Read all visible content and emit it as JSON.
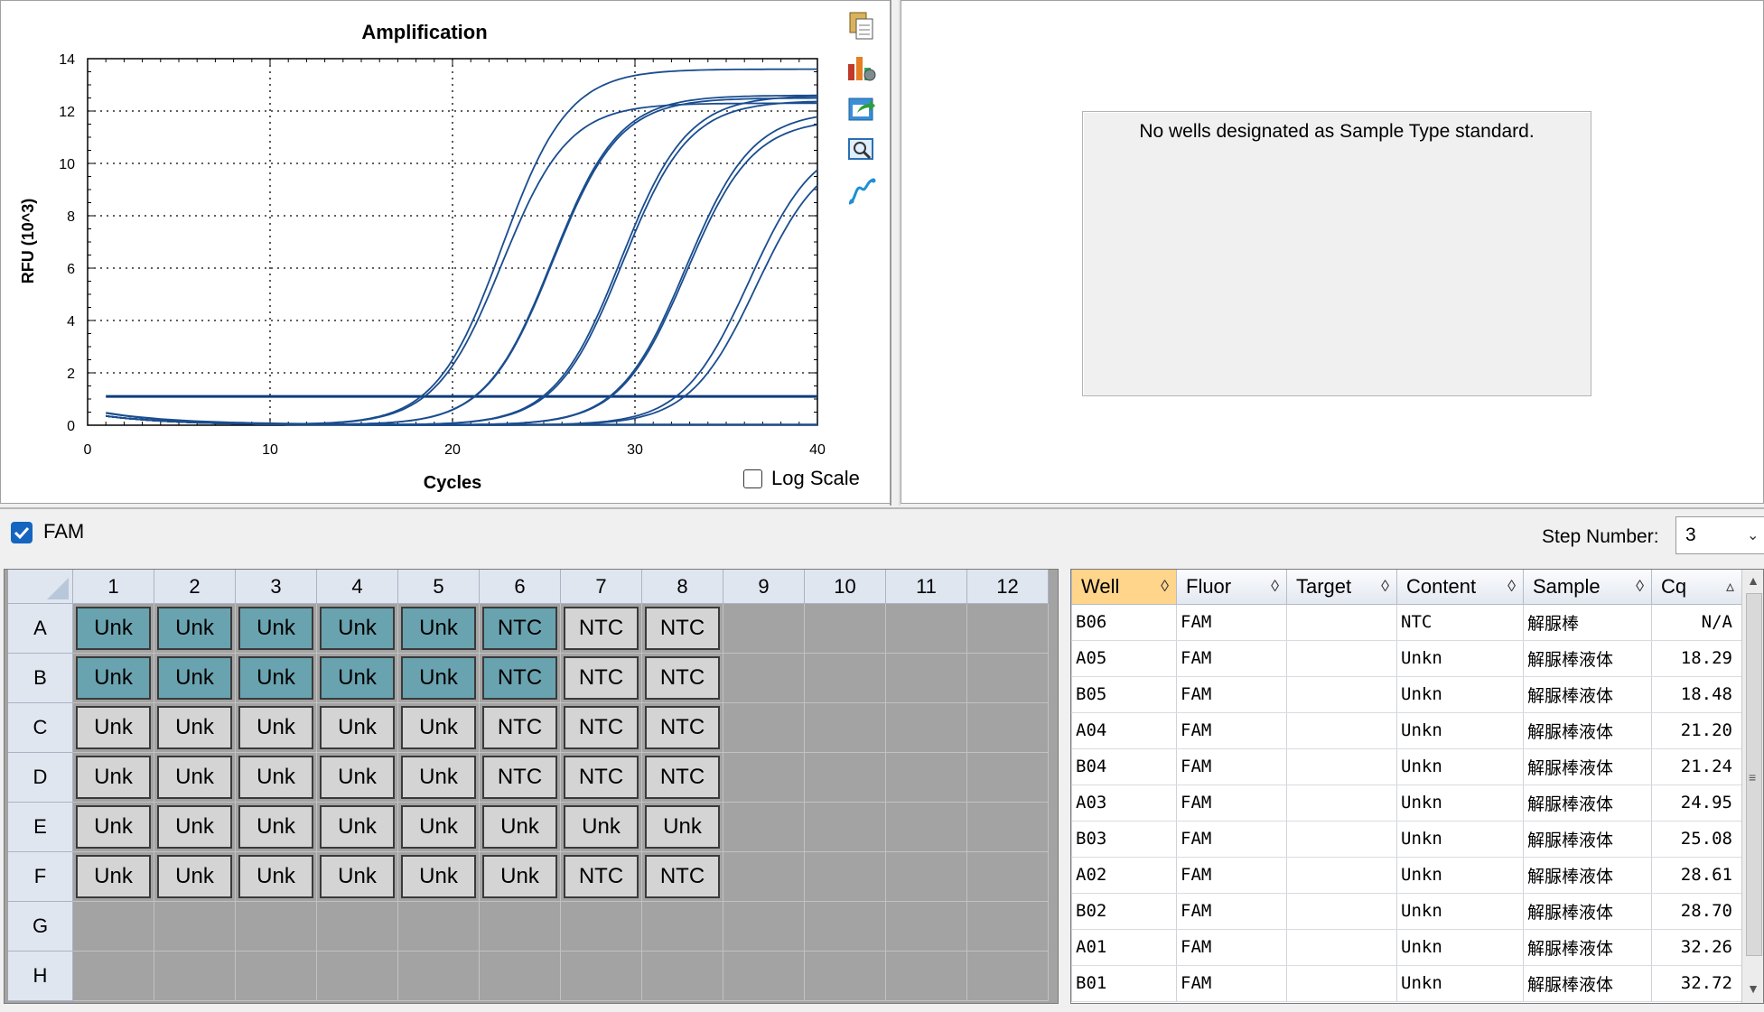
{
  "chart": {
    "title_label": "Amplification",
    "log_scale_label": "Log Scale"
  },
  "chart_data": {
    "type": "line",
    "title": "Amplification",
    "xlabel": "Cycles",
    "ylabel": "RFU (10^3)",
    "xlim": [
      0,
      40
    ],
    "ylim": [
      0,
      14
    ],
    "x_ticks": [
      0,
      10,
      20,
      30,
      40
    ],
    "y_ticks": [
      0,
      2,
      4,
      6,
      8,
      10,
      12,
      14
    ],
    "grid": true,
    "threshold": 1.1,
    "series": [
      {
        "cq": 18.29,
        "plateau": 13.6
      },
      {
        "cq": 18.48,
        "plateau": 12.3
      },
      {
        "cq": 21.2,
        "plateau": 12.6
      },
      {
        "cq": 21.24,
        "plateau": 12.5
      },
      {
        "cq": 24.95,
        "plateau": 12.6
      },
      {
        "cq": 25.08,
        "plateau": 12.4
      },
      {
        "cq": 28.61,
        "plateau": 12.0
      },
      {
        "cq": 28.7,
        "plateau": 11.7
      },
      {
        "cq": 32.26,
        "plateau": 11.0
      },
      {
        "cq": 32.72,
        "plateau": 10.6
      }
    ]
  },
  "standard_panel": {
    "message": "No wells designated as Sample Type standard."
  },
  "fluor_bar": {
    "fluor_label": "FAM",
    "step_label": "Step Number:",
    "step_value": "3"
  },
  "plate": {
    "columns": [
      "1",
      "2",
      "3",
      "4",
      "5",
      "6",
      "7",
      "8",
      "9",
      "10",
      "11",
      "12"
    ],
    "rows": [
      {
        "label": "A",
        "wells": [
          [
            "Unk",
            1
          ],
          [
            "Unk",
            1
          ],
          [
            "Unk",
            1
          ],
          [
            "Unk",
            1
          ],
          [
            "Unk",
            1
          ],
          [
            "NTC",
            1
          ],
          [
            "NTC",
            0
          ],
          [
            "NTC",
            0
          ]
        ]
      },
      {
        "label": "B",
        "wells": [
          [
            "Unk",
            1
          ],
          [
            "Unk",
            1
          ],
          [
            "Unk",
            1
          ],
          [
            "Unk",
            1
          ],
          [
            "Unk",
            1
          ],
          [
            "NTC",
            1
          ],
          [
            "NTC",
            0
          ],
          [
            "NTC",
            0
          ]
        ]
      },
      {
        "label": "C",
        "wells": [
          [
            "Unk",
            0
          ],
          [
            "Unk",
            0
          ],
          [
            "Unk",
            0
          ],
          [
            "Unk",
            0
          ],
          [
            "Unk",
            0
          ],
          [
            "NTC",
            0
          ],
          [
            "NTC",
            0
          ],
          [
            "NTC",
            0
          ]
        ]
      },
      {
        "label": "D",
        "wells": [
          [
            "Unk",
            0
          ],
          [
            "Unk",
            0
          ],
          [
            "Unk",
            0
          ],
          [
            "Unk",
            0
          ],
          [
            "Unk",
            0
          ],
          [
            "NTC",
            0
          ],
          [
            "NTC",
            0
          ],
          [
            "NTC",
            0
          ]
        ]
      },
      {
        "label": "E",
        "wells": [
          [
            "Unk",
            0
          ],
          [
            "Unk",
            0
          ],
          [
            "Unk",
            0
          ],
          [
            "Unk",
            0
          ],
          [
            "Unk",
            0
          ],
          [
            "Unk",
            0
          ],
          [
            "Unk",
            0
          ],
          [
            "Unk",
            0
          ]
        ]
      },
      {
        "label": "F",
        "wells": [
          [
            "Unk",
            0
          ],
          [
            "Unk",
            0
          ],
          [
            "Unk",
            0
          ],
          [
            "Unk",
            0
          ],
          [
            "Unk",
            0
          ],
          [
            "Unk",
            0
          ],
          [
            "NTC",
            0
          ],
          [
            "NTC",
            0
          ]
        ]
      },
      {
        "label": "G",
        "wells": []
      },
      {
        "label": "H",
        "wells": []
      }
    ]
  },
  "results": {
    "headers": [
      {
        "label": "Well",
        "sort": "◊"
      },
      {
        "label": "Fluor",
        "sort": "◊"
      },
      {
        "label": "Target",
        "sort": "◊"
      },
      {
        "label": "Content",
        "sort": "◊"
      },
      {
        "label": "Sample",
        "sort": "◊"
      },
      {
        "label": "Cq",
        "sort": "▵"
      }
    ],
    "rows": [
      [
        "B06",
        "FAM",
        "",
        "NTC",
        "解脲棒",
        "N/A"
      ],
      [
        "A05",
        "FAM",
        "",
        "Unkn",
        "解脲棒液体",
        "18.29"
      ],
      [
        "B05",
        "FAM",
        "",
        "Unkn",
        "解脲棒液体",
        "18.48"
      ],
      [
        "A04",
        "FAM",
        "",
        "Unkn",
        "解脲棒液体",
        "21.20"
      ],
      [
        "B04",
        "FAM",
        "",
        "Unkn",
        "解脲棒液体",
        "21.24"
      ],
      [
        "A03",
        "FAM",
        "",
        "Unkn",
        "解脲棒液体",
        "24.95"
      ],
      [
        "B03",
        "FAM",
        "",
        "Unkn",
        "解脲棒液体",
        "25.08"
      ],
      [
        "A02",
        "FAM",
        "",
        "Unkn",
        "解脲棒液体",
        "28.61"
      ],
      [
        "B02",
        "FAM",
        "",
        "Unkn",
        "解脲棒液体",
        "28.70"
      ],
      [
        "A01",
        "FAM",
        "",
        "Unkn",
        "解脲棒液体",
        "32.26"
      ],
      [
        "B01",
        "FAM",
        "",
        "Unkn",
        "解脲棒液体",
        "32.72"
      ]
    ]
  },
  "toolbar_icons": [
    "copy-icon",
    "chart-settings-icon",
    "export-icon",
    "zoom-icon",
    "curve-icon"
  ]
}
